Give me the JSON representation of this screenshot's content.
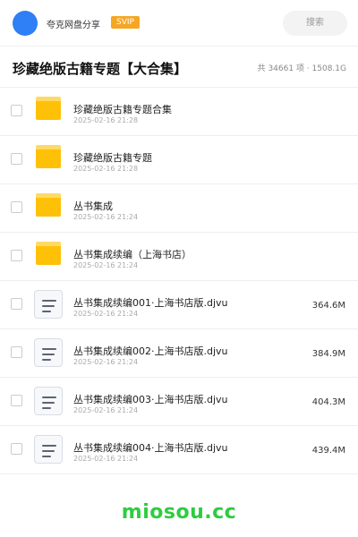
{
  "header": {
    "app_name": "夸克网盘分享",
    "badge": "SVIP",
    "search_label": "搜索"
  },
  "title_bar": {
    "title": "珍藏绝版古籍专题【大合集】",
    "stats": "共 34661 项 · 1508.1G"
  },
  "files": [
    {
      "type": "folder",
      "name": "珍藏绝版古籍专题合集",
      "date": "2025-02-16 21:28",
      "size": ""
    },
    {
      "type": "folder",
      "name": "珍藏绝版古籍专题",
      "date": "2025-02-16 21:28",
      "size": ""
    },
    {
      "type": "folder",
      "name": "丛书集成",
      "date": "2025-02-16 21:24",
      "size": ""
    },
    {
      "type": "folder",
      "name": "丛书集成续编（上海书店）",
      "date": "2025-02-16 21:24",
      "size": ""
    },
    {
      "type": "file",
      "name": "丛书集成续编001·上海书店版.djvu",
      "date": "2025-02-16 21:24",
      "size": "364.6M"
    },
    {
      "type": "file",
      "name": "丛书集成续编002·上海书店版.djvu",
      "date": "2025-02-16 21:24",
      "size": "384.9M"
    },
    {
      "type": "file",
      "name": "丛书集成续编003·上海书店版.djvu",
      "date": "2025-02-16 21:24",
      "size": "404.3M"
    },
    {
      "type": "file",
      "name": "丛书集成续编004·上海书店版.djvu",
      "date": "2025-02-16 21:24",
      "size": "439.4M"
    }
  ],
  "watermark": "miosou.cc",
  "colors": {
    "accent_blue": "#2f7ff6",
    "svip_orange": "#f5a623",
    "folder_yellow": "#ffc107",
    "watermark_green": "#2ecc40"
  }
}
